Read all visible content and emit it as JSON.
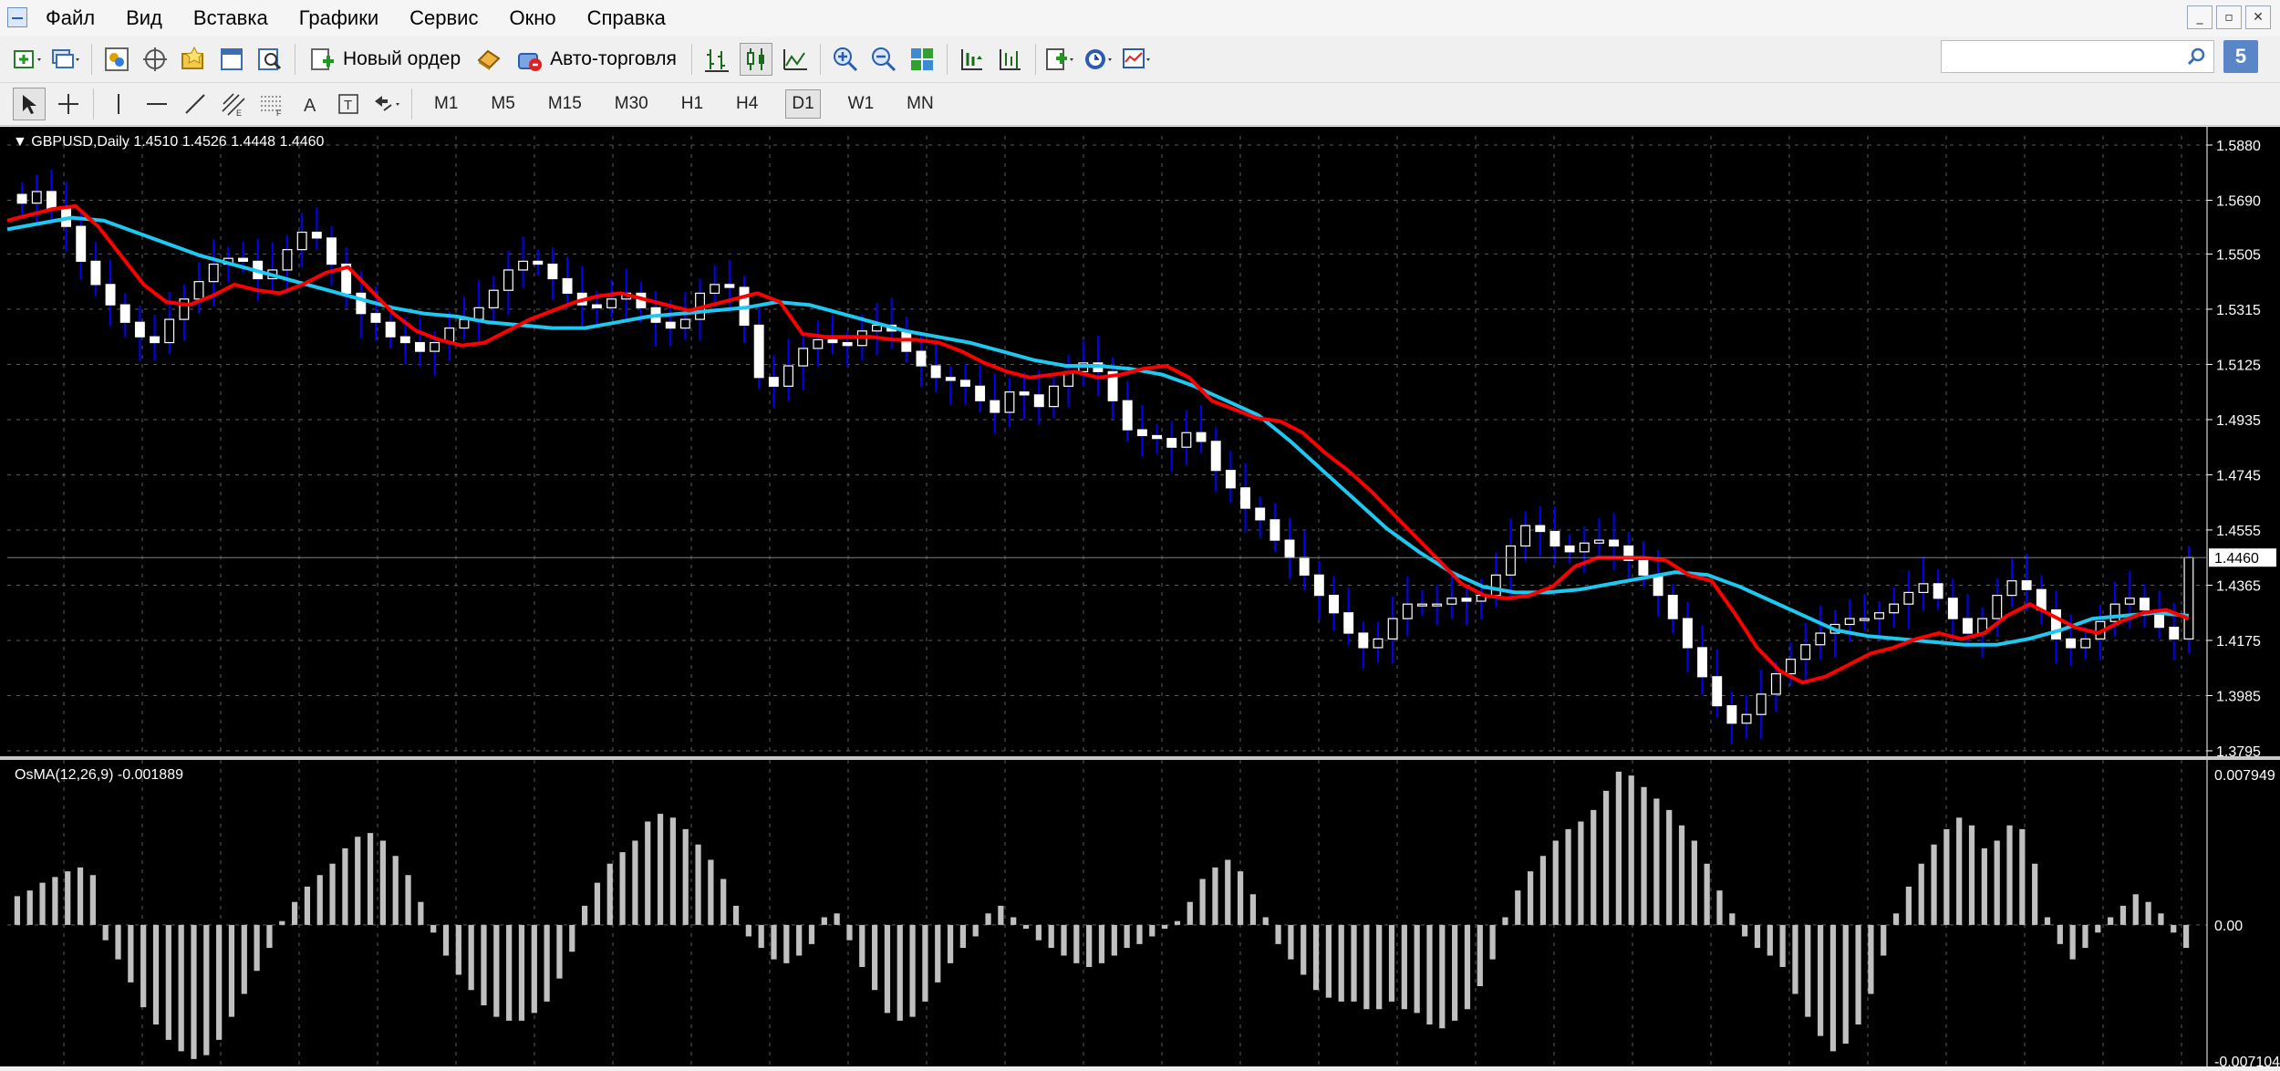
{
  "menu": {
    "items": [
      "Файл",
      "Вид",
      "Вставка",
      "Графики",
      "Сервис",
      "Окно",
      "Справка"
    ]
  },
  "window_controls": [
    "_",
    "▫",
    "✕"
  ],
  "toolbar": {
    "new_order_label": "Новый ордер",
    "auto_trading_label": "Авто-торговля",
    "search_placeholder": "",
    "help_label": "5"
  },
  "timeframes": [
    "M1",
    "M5",
    "M15",
    "M30",
    "H1",
    "H4",
    "D1",
    "W1",
    "MN"
  ],
  "active_timeframe": "D1",
  "chart": {
    "symbol_label": "GBPUSD,Daily",
    "ohlc_label": "1.4510 1.4526 1.4448 1.4460",
    "current_price_label": "1.4460",
    "price_ticks": [
      "1.5880",
      "1.5690",
      "1.5505",
      "1.5315",
      "1.5125",
      "1.4935",
      "1.4745",
      "1.4555",
      "1.4365",
      "1.4175",
      "1.3985",
      "1.3795"
    ],
    "colors": {
      "background": "#000000",
      "grid": "#5a5a5a",
      "bull_candle": "#ffffff",
      "bear_candle": "#ffffff",
      "wick": "#0000ff",
      "ma_fast": "#ff0000",
      "ma_slow": "#1ec8f0",
      "osma": "#c0c0c0"
    }
  },
  "osma": {
    "title_label": "OsMA(12,26,9) -0.001889",
    "tick_top": "0.007949",
    "tick_zero": "0.00",
    "tick_bottom": "-0.007104"
  },
  "chart_data": {
    "type": "line",
    "title": "GBPUSD,Daily",
    "ylim": [
      1.3795,
      1.588
    ],
    "close_approx": [
      1.568,
      1.572,
      1.566,
      1.56,
      1.548,
      1.54,
      1.533,
      1.527,
      1.522,
      1.52,
      1.528,
      1.535,
      1.541,
      1.547,
      1.549,
      1.548,
      1.542,
      1.545,
      1.552,
      1.558,
      1.556,
      1.547,
      1.537,
      1.53,
      1.527,
      1.522,
      1.52,
      1.517,
      1.52,
      1.525,
      1.528,
      1.532,
      1.538,
      1.545,
      1.548,
      1.547,
      1.542,
      1.537,
      1.533,
      1.532,
      1.535,
      1.537,
      1.532,
      1.527,
      1.525,
      1.528,
      1.537,
      1.54,
      1.539,
      1.526,
      1.508,
      1.505,
      1.512,
      1.518,
      1.521,
      1.52,
      1.519,
      1.524,
      1.526,
      1.524,
      1.517,
      1.512,
      1.508,
      1.507,
      1.505,
      1.5,
      1.496,
      1.503,
      1.502,
      1.498,
      1.505,
      1.51,
      1.513,
      1.51,
      1.5,
      1.49,
      1.488,
      1.487,
      1.484,
      1.489,
      1.486,
      1.476,
      1.47,
      1.463,
      1.459,
      1.452,
      1.446,
      1.44,
      1.433,
      1.427,
      1.42,
      1.415,
      1.418,
      1.425,
      1.43,
      1.43,
      1.43,
      1.432,
      1.431,
      1.433,
      1.44,
      1.45,
      1.457,
      1.455,
      1.45,
      1.448,
      1.451,
      1.452,
      1.45,
      1.445,
      1.44,
      1.433,
      1.425,
      1.415,
      1.405,
      1.395,
      1.389,
      1.392,
      1.399,
      1.406,
      1.411,
      1.416,
      1.42,
      1.423,
      1.425,
      1.425,
      1.427,
      1.43,
      1.434,
      1.437,
      1.432,
      1.425,
      1.42,
      1.425,
      1.433,
      1.438,
      1.435,
      1.428,
      1.418,
      1.415,
      1.418,
      1.424,
      1.43,
      1.432,
      1.428,
      1.422,
      1.418,
      1.446
    ],
    "ma_fast_approx": [
      1.562,
      1.564,
      1.566,
      1.567,
      1.56,
      1.55,
      1.54,
      1.534,
      1.533,
      1.536,
      1.54,
      1.538,
      1.537,
      1.54,
      1.544,
      1.546,
      1.538,
      1.53,
      1.524,
      1.521,
      1.519,
      1.52,
      1.524,
      1.528,
      1.531,
      1.534,
      1.536,
      1.537,
      1.535,
      1.533,
      1.531,
      1.533,
      1.535,
      1.537,
      1.534,
      1.523,
      1.522,
      1.522,
      1.522,
      1.521,
      1.521,
      1.52,
      1.517,
      1.513,
      1.51,
      1.508,
      1.509,
      1.51,
      1.508,
      1.509,
      1.511,
      1.512,
      1.508,
      1.5,
      1.497,
      1.494,
      1.493,
      1.489,
      1.482,
      1.476,
      1.469,
      1.461,
      1.453,
      1.445,
      1.437,
      1.433,
      1.432,
      1.433,
      1.436,
      1.443,
      1.446,
      1.446,
      1.446,
      1.445,
      1.44,
      1.438,
      1.427,
      1.415,
      1.407,
      1.403,
      1.405,
      1.409,
      1.413,
      1.415,
      1.418,
      1.42,
      1.418,
      1.42,
      1.426,
      1.43,
      1.426,
      1.422,
      1.42,
      1.424,
      1.427,
      1.428,
      1.425
    ],
    "ma_slow_approx": [
      1.559,
      1.561,
      1.563,
      1.562,
      1.558,
      1.554,
      1.55,
      1.547,
      1.544,
      1.541,
      1.538,
      1.535,
      1.532,
      1.53,
      1.529,
      1.527,
      1.526,
      1.525,
      1.525,
      1.527,
      1.529,
      1.53,
      1.531,
      1.532,
      1.534,
      1.533,
      1.53,
      1.527,
      1.524,
      1.522,
      1.52,
      1.517,
      1.514,
      1.512,
      1.512,
      1.511,
      1.509,
      1.505,
      1.5,
      1.495,
      1.486,
      1.476,
      1.466,
      1.456,
      1.448,
      1.441,
      1.436,
      1.434,
      1.434,
      1.435,
      1.437,
      1.439,
      1.441,
      1.44,
      1.436,
      1.431,
      1.426,
      1.421,
      1.419,
      1.418,
      1.417,
      1.416,
      1.416,
      1.418,
      1.421,
      1.425,
      1.426,
      1.427,
      1.426
    ],
    "osma_ylim": [
      -0.007104,
      0.007949
    ],
    "osma_values": [
      0.0015,
      0.0018,
      0.0022,
      0.0025,
      0.0028,
      0.003,
      0.0026,
      -0.0008,
      -0.0018,
      -0.003,
      -0.0043,
      -0.0052,
      -0.006,
      -0.0066,
      -0.007,
      -0.0068,
      -0.006,
      -0.0048,
      -0.0036,
      -0.0024,
      -0.0012,
      0.0002,
      0.0012,
      0.002,
      0.0026,
      0.0032,
      0.004,
      0.0046,
      0.0048,
      0.0044,
      0.0036,
      0.0026,
      0.0012,
      -0.0004,
      -0.0016,
      -0.0026,
      -0.0034,
      -0.0042,
      -0.0048,
      -0.005,
      -0.005,
      -0.0046,
      -0.004,
      -0.0028,
      -0.0014,
      0.001,
      0.0022,
      0.0032,
      0.0038,
      0.0044,
      0.0054,
      0.0058,
      0.0056,
      0.005,
      0.0042,
      0.0034,
      0.0024,
      0.001,
      -0.0006,
      -0.0012,
      -0.0018,
      -0.002,
      -0.0016,
      -0.001,
      0.0004,
      0.0006,
      -0.0008,
      -0.0022,
      -0.0034,
      -0.0046,
      -0.005,
      -0.0048,
      -0.004,
      -0.003,
      -0.002,
      -0.0012,
      -0.0006,
      0.0006,
      0.001,
      0.0004,
      -0.0002,
      -0.0008,
      -0.0012,
      -0.0016,
      -0.002,
      -0.0022,
      -0.002,
      -0.0016,
      -0.0012,
      -0.001,
      -0.0006,
      -0.0002,
      0.0002,
      0.0012,
      0.0024,
      0.003,
      0.0034,
      0.0028,
      0.0016,
      0.0004,
      -0.001,
      -0.0018,
      -0.0026,
      -0.0034,
      -0.0038,
      -0.004,
      -0.004,
      -0.0044,
      -0.0044,
      -0.004,
      -0.0044,
      -0.0046,
      -0.0052,
      -0.0054,
      -0.005,
      -0.0044,
      -0.0032,
      -0.0018,
      0.0004,
      0.0018,
      0.0028,
      0.0036,
      0.0044,
      0.005,
      0.0054,
      0.006,
      0.007,
      0.008,
      0.0078,
      0.0072,
      0.0066,
      0.006,
      0.0052,
      0.0044,
      0.0032,
      0.0018,
      0.0006,
      -0.0006,
      -0.0012,
      -0.0016,
      -0.0022,
      -0.0036,
      -0.0048,
      -0.0058,
      -0.0066,
      -0.0062,
      -0.0052,
      -0.0036,
      -0.0016,
      0.0006,
      0.002,
      0.0032,
      0.0042,
      0.005,
      0.0056,
      0.0052,
      0.004,
      0.0044,
      0.0052,
      0.005,
      0.0032,
      0.0004,
      -0.001,
      -0.0018,
      -0.0012,
      -0.0004,
      0.0004,
      0.001,
      0.0016,
      0.0012,
      0.0006,
      -0.0004,
      -0.0012
    ]
  }
}
